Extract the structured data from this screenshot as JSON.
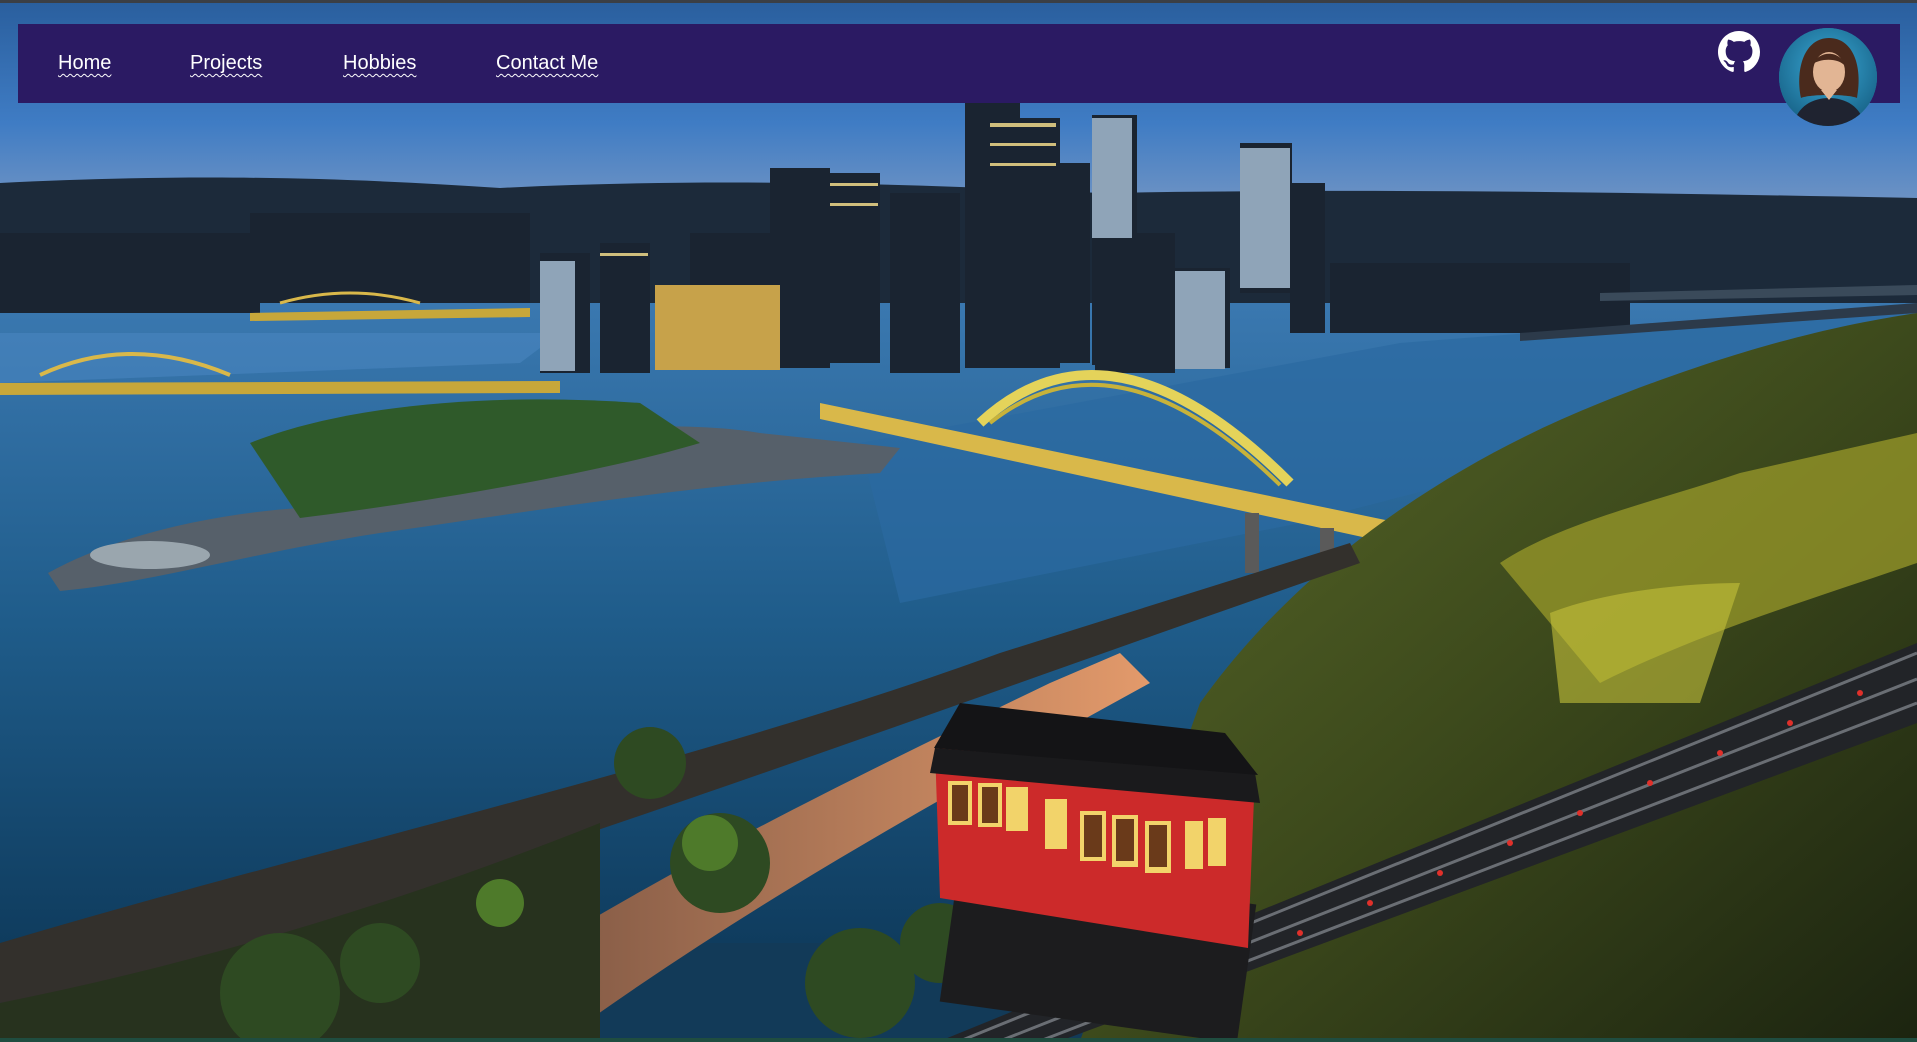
{
  "nav": {
    "items": [
      {
        "label": "Home"
      },
      {
        "label": "Projects"
      },
      {
        "label": "Hobbies"
      },
      {
        "label": "Contact Me"
      }
    ]
  },
  "icons": {
    "github": "github-icon",
    "avatar": "profile-photo"
  },
  "colors": {
    "navbar": "#2b1a63",
    "nav_text": "#ffffff"
  }
}
